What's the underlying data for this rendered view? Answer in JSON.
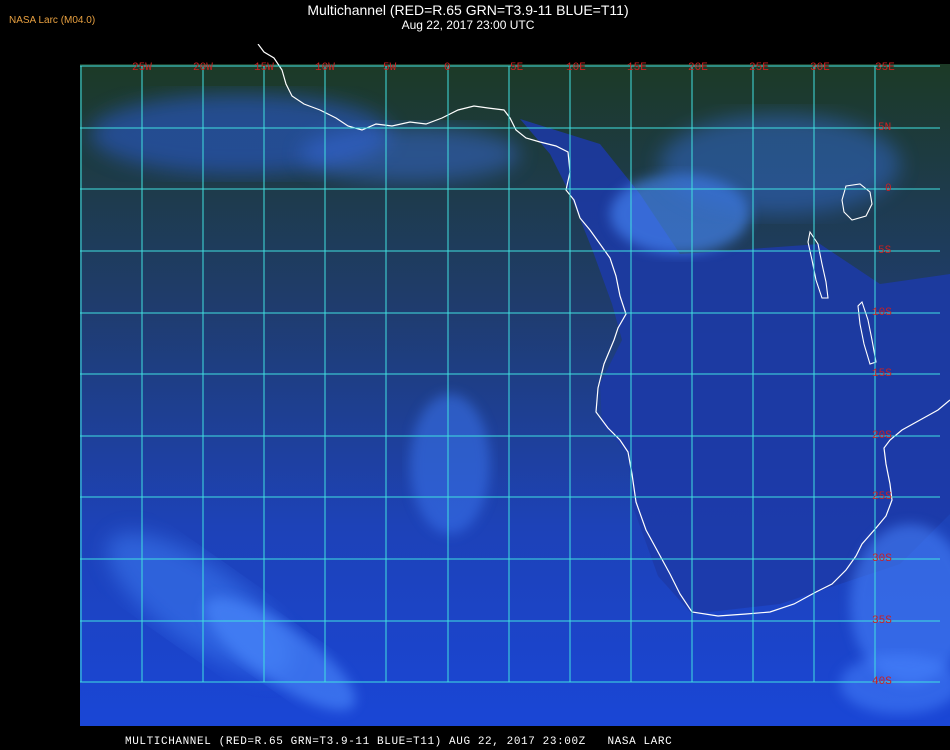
{
  "header": {
    "credit": "NASA Larc (M04.0)",
    "title": "Multichannel (RED=R.65 GRN=T3.9-11 BLUE=T11)",
    "subtitle": "Aug 22, 2017 23:00 UTC"
  },
  "footer": {
    "caption": "MULTICHANNEL (RED=R.65 GRN=T3.9-11 BLUE=T11) AUG 22, 2017 23:00Z   NASA LARC"
  },
  "map": {
    "longitude_labels": [
      "25W",
      "20W",
      "15W",
      "10W",
      "5W",
      "0",
      "5E",
      "10E",
      "15E",
      "20E",
      "25E",
      "30E",
      "35E"
    ],
    "latitude_labels": [
      "5N",
      "0",
      "5S",
      "10S",
      "15S",
      "20S",
      "25S",
      "30S",
      "35S",
      "40S"
    ],
    "colors": {
      "grid": "#40e0e0",
      "label": "#cc2020",
      "coast": "#ffffff",
      "ocean": "#1a40c8",
      "land_north": "#1e3a0e"
    }
  }
}
